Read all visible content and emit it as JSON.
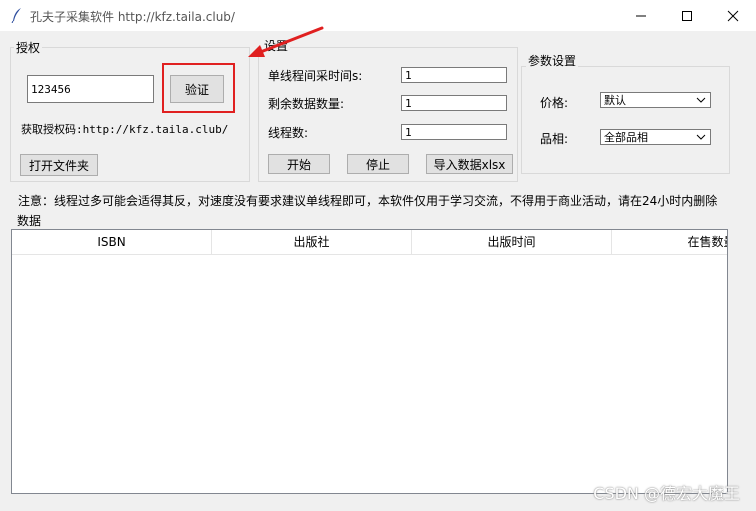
{
  "window": {
    "title": "孔夫子采集软件 http://kfz.taila.club/"
  },
  "auth": {
    "group_title": "授权",
    "code_value": "123456",
    "verify_label": "验证",
    "get_code_text": "获取授权码:http://kfz.taila.club/",
    "open_folder_label": "打开文件夹"
  },
  "settings": {
    "group_title": "设置",
    "interval_label": "单线程间采时间s:",
    "interval_value": "1",
    "remaining_label": "剩余数据数量:",
    "remaining_value": "1",
    "threads_label": "线程数:",
    "threads_value": "1",
    "start_label": "开始",
    "stop_label": "停止",
    "export_label": "导入数据xlsx"
  },
  "params": {
    "group_title": "参数设置",
    "price_label": "价格:",
    "price_value": "默认",
    "category_label": "品相:",
    "category_value": "全部品相"
  },
  "notice": "注意：线程过多可能会适得其反，对速度没有要求建议单线程即可，本软件仅用于学习交流，不得用于商业活动，请在24小时内删除",
  "data": {
    "group_title": "数据",
    "columns": [
      "ISBN",
      "出版社",
      "出版时间",
      "在售数量"
    ]
  },
  "watermark": "CSDN @德宏大魔王",
  "colors": {
    "highlight": "#e02020",
    "arrow": "#e02020"
  }
}
